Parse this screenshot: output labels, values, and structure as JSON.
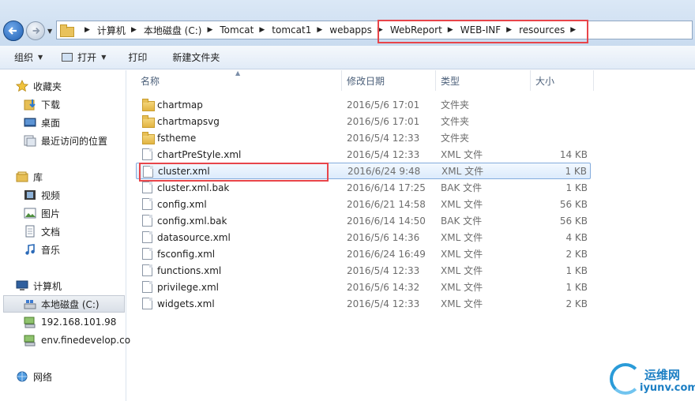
{
  "address_bar": {
    "crumbs": [
      "计算机",
      "本地磁盘 (C:)",
      "Tomcat",
      "tomcat1",
      "webapps",
      "WebReport",
      "WEB-INF",
      "resources"
    ]
  },
  "toolbar": {
    "organize": "组织",
    "open": "打开",
    "print": "打印",
    "new_folder": "新建文件夹"
  },
  "sidebar": {
    "favorites": "收藏夹",
    "downloads": "下载",
    "desktop": "桌面",
    "recent": "最近访问的位置",
    "libraries": "库",
    "videos": "视频",
    "pictures": "图片",
    "documents": "文档",
    "music": "音乐",
    "computer": "计算机",
    "local_disk": "本地磁盘 (C:)",
    "net1": "192.168.101.98",
    "net2": "env.finedevelop.co",
    "network": "网络"
  },
  "columns": {
    "name": "名称",
    "modified": "修改日期",
    "type": "类型",
    "size": "大小"
  },
  "files": [
    {
      "name": "chartmap",
      "date": "2016/5/6 17:01",
      "type": "文件夹",
      "size": "",
      "kind": "folder"
    },
    {
      "name": "chartmapsvg",
      "date": "2016/5/6 17:01",
      "type": "文件夹",
      "size": "",
      "kind": "folder"
    },
    {
      "name": "fstheme",
      "date": "2016/5/4 12:33",
      "type": "文件夹",
      "size": "",
      "kind": "folder"
    },
    {
      "name": "chartPreStyle.xml",
      "date": "2016/5/4 12:33",
      "type": "XML 文件",
      "size": "14 KB",
      "kind": "file"
    },
    {
      "name": "cluster.xml",
      "date": "2016/6/24 9:48",
      "type": "XML 文件",
      "size": "1 KB",
      "kind": "file"
    },
    {
      "name": "cluster.xml.bak",
      "date": "2016/6/14 17:25",
      "type": "BAK 文件",
      "size": "1 KB",
      "kind": "file"
    },
    {
      "name": "config.xml",
      "date": "2016/6/21 14:58",
      "type": "XML 文件",
      "size": "56 KB",
      "kind": "file"
    },
    {
      "name": "config.xml.bak",
      "date": "2016/6/14 14:50",
      "type": "BAK 文件",
      "size": "56 KB",
      "kind": "file"
    },
    {
      "name": "datasource.xml",
      "date": "2016/5/6 14:36",
      "type": "XML 文件",
      "size": "4 KB",
      "kind": "file"
    },
    {
      "name": "fsconfig.xml",
      "date": "2016/6/24 16:49",
      "type": "XML 文件",
      "size": "2 KB",
      "kind": "file"
    },
    {
      "name": "functions.xml",
      "date": "2016/5/4 12:33",
      "type": "XML 文件",
      "size": "1 KB",
      "kind": "file"
    },
    {
      "name": "privilege.xml",
      "date": "2016/5/6 14:32",
      "type": "XML 文件",
      "size": "1 KB",
      "kind": "file"
    },
    {
      "name": "widgets.xml",
      "date": "2016/5/4 12:33",
      "type": "XML 文件",
      "size": "2 KB",
      "kind": "file"
    }
  ],
  "watermark": {
    "title": "运维网",
    "subtitle": "iyunv.com"
  }
}
